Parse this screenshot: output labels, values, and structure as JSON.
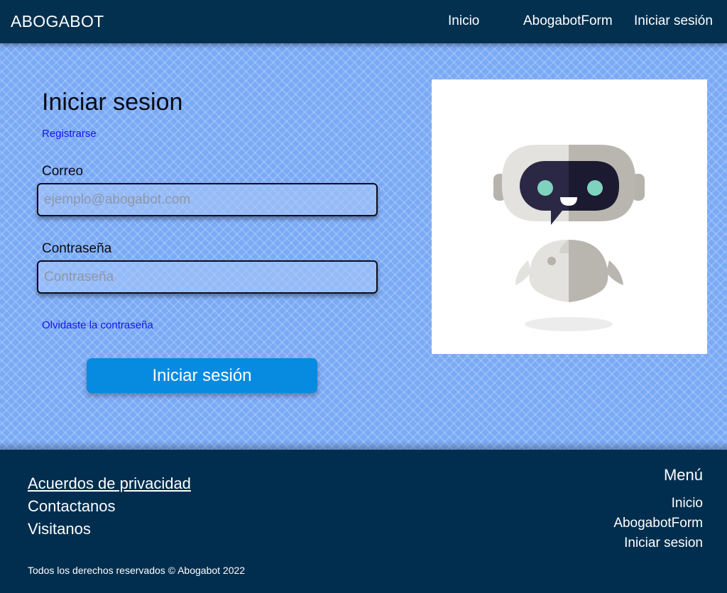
{
  "navbar": {
    "brand": "ABOGABOT",
    "links": [
      "Inicio",
      "AbogabotForm",
      "Iniciar sesión"
    ]
  },
  "login": {
    "title": "Iniciar sesion",
    "register_link": "Registrarse",
    "email_label": "Correo",
    "email_placeholder": "ejemplo@abogabot.com",
    "email_value": "",
    "password_label": "Contraseña",
    "password_placeholder": "Contraseña",
    "password_value": "",
    "forgot_link": "Olvidaste la contraseña",
    "submit_label": "Iniciar sesión"
  },
  "illustration": {
    "icon": "robot-mascot-icon"
  },
  "footer": {
    "links": [
      "Acuerdos de privacidad",
      "Contactanos",
      "Visitanos"
    ],
    "menu_title": "Menú",
    "menu_links": [
      "Inicio",
      "AbogabotForm",
      "Iniciar sesion"
    ],
    "copyright": "Todos los derechos reservados © Abogabot 2022"
  },
  "colors": {
    "navbar": "#03304f",
    "background": "#7aaaf5",
    "button": "#078be0",
    "link": "#1414f0"
  }
}
